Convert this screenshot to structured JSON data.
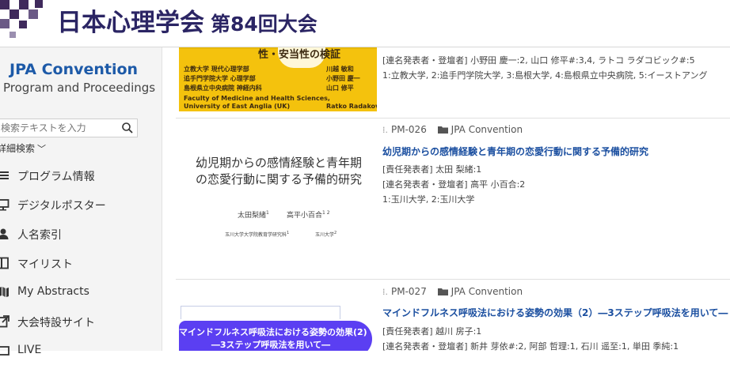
{
  "header": {
    "title": "日本心理学会",
    "subtitle": "第84回大会",
    "brand_color": "#2b2564",
    "logo_color": "#3f2a5c"
  },
  "sidebar": {
    "convention_title": "JPA Convention",
    "convention_subtitle": "Program and Proceedings",
    "search": {
      "placeholder": "検索テキストを入力",
      "icon": "search-icon"
    },
    "advanced_search": "詳細検索",
    "items": [
      {
        "label": "プログラム情報",
        "icon": "list-icon"
      },
      {
        "label": "デジタルポスター",
        "icon": "monitor-icon"
      },
      {
        "label": "人名索引",
        "icon": "person-icon"
      },
      {
        "label": "マイリスト",
        "icon": "bookmark-icon"
      },
      {
        "label": "My Abstracts",
        "icon": "book-icon"
      },
      {
        "label": "大会特設サイト",
        "icon": "external-link-icon"
      },
      {
        "label": "LIVE",
        "icon": "live-icon"
      }
    ]
  },
  "entries": [
    {
      "co_authors": "[連名発表者・登壇者] 小野田 慶一:2, 山口 修平#:3,4, ラトコ ラダコビック#:5",
      "affiliations": "1:立教大学, 2:追手門学院大学, 3:島根大学, 4:島根県立中央病院, 5:イーストアング",
      "thumb": {
        "heading": "性・安当性の検証",
        "left_lines": [
          "立教大学 現代心理学部",
          "追手門学院大学 心理学部",
          "島根県立中央病院 神経内科"
        ],
        "right_lines": [
          "川越 敏和",
          "小野田 慶一",
          "山口 修平"
        ],
        "footer_left": [
          "Faculty of Medicine and Health Sciences,",
          "University of East Anglia (UK)"
        ],
        "footer_right": "Ratko Radakovic"
      }
    },
    {
      "code": "PM-026",
      "category": "JPA Convention",
      "title": "幼児期からの感情経験と青年期の恋愛行動に関する予備的研究",
      "presenter": "[責任発表者] 太田 梨緒:1",
      "co_authors": "[連名発表者・登壇者] 高平 小百合:2",
      "affiliations": "1:玉川大学, 2:玉川大学",
      "thumb": {
        "title_line1": "幼児期からの感情経験と青年期",
        "title_line2": "の恋愛行動に関する予備的研究",
        "author1": "太田梨緒",
        "author1_sup": "1",
        "author2": "高平小百合",
        "author2_sup": "1 2",
        "affil1": "玉川大学大学院教育学研究科",
        "affil1_sup": "1",
        "affil2": "玉川大学",
        "affil2_sup": "2"
      }
    },
    {
      "code": "PM-027",
      "category": "JPA Convention",
      "title": "マインドフルネス呼吸法における姿勢の効果（2）―3ステップ呼吸法を用いて―",
      "presenter": "[責任発表者] 越川 房子:1",
      "co_authors": "[連名発表者・登壇者] 新井 芽依#:2, 阿部 哲理:1, 石川 遥至:1, 単田 季純:1",
      "thumb": {
        "banner_line1": "マインドフルネス呼吸法における姿勢の効果(2)",
        "banner_line2": "―3ステップ呼吸法を用いて―",
        "banner_color": "#5b3ff2"
      }
    }
  ],
  "colors": {
    "link": "#1b4fa0",
    "accent_blue": "#1d5aa8",
    "poster_yellow": "#f4c20d"
  }
}
